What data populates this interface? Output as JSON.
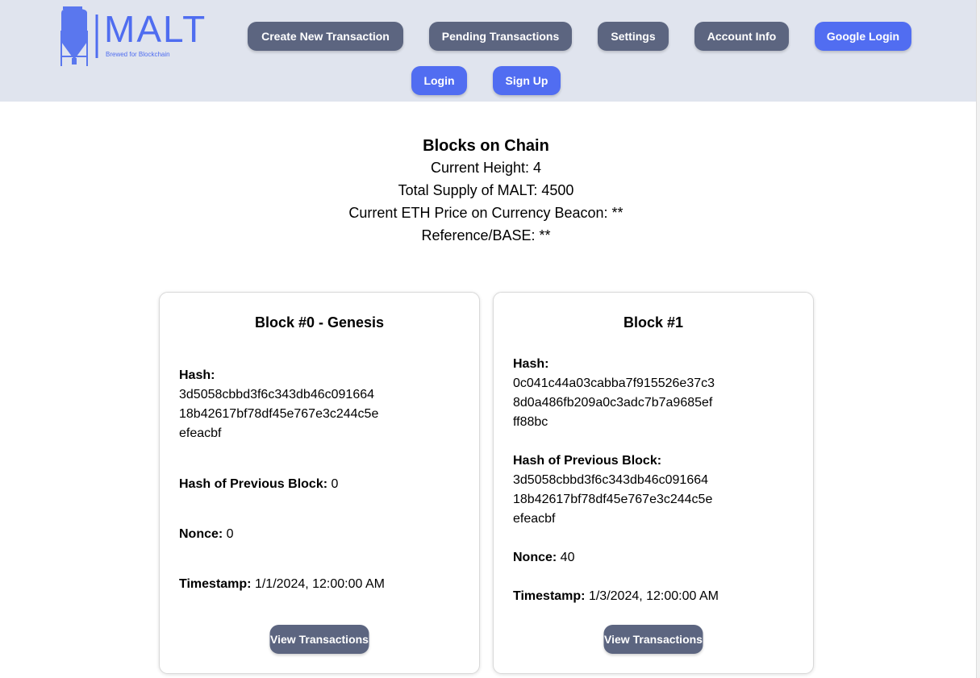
{
  "logo": {
    "word": "MALT",
    "tagline": "Brewed for Blockchain",
    "icon": "fermenter-tank-icon",
    "color": "#4f6df0"
  },
  "nav": {
    "create_transaction": "Create New Transaction",
    "pending_transactions": "Pending Transactions",
    "settings": "Settings",
    "account_info": "Account Info",
    "google_login": "Google Login",
    "login": "Login",
    "sign_up": "Sign Up"
  },
  "colors": {
    "header_bg": "#e0e4ee",
    "button_gray": "#5c6580",
    "button_blue": "#516df1"
  },
  "summary": {
    "title": "Blocks on Chain",
    "current_height": "Current Height: 4",
    "total_supply": "Total Supply of MALT: 4500",
    "eth_price": "Current ETH Price on Currency Beacon: **",
    "reference_base": "Reference/BASE: **"
  },
  "blocks": [
    {
      "title": "Block #0 - Genesis",
      "hash_label": "Hash:",
      "hash_lines": [
        "3d5058cbbd3f6c343db46c091664",
        "18b42617bf78df45e767e3c244c5e",
        "efeacbf"
      ],
      "prev_hash_label": "Hash of Previous Block:",
      "prev_hash_value": "0",
      "nonce_label": "Nonce:",
      "nonce_value": "0",
      "timestamp_label": "Timestamp:",
      "timestamp_value": "1/1/2024, 12:00:00 AM",
      "view_button": "View Transactions"
    },
    {
      "title": "Block #1",
      "hash_label": "Hash:",
      "hash_lines": [
        "0c041c44a03cabba7f915526e37c3",
        "8d0a486fb209a0c3adc7b7a9685ef",
        "ff88bc"
      ],
      "prev_hash_label": "Hash of Previous Block:",
      "prev_hash_lines": [
        "3d5058cbbd3f6c343db46c091664",
        "18b42617bf78df45e767e3c244c5e",
        "efeacbf"
      ],
      "nonce_label": "Nonce:",
      "nonce_value": "40",
      "timestamp_label": "Timestamp:",
      "timestamp_value": "1/3/2024, 12:00:00 AM",
      "view_button": "View Transactions"
    }
  ]
}
